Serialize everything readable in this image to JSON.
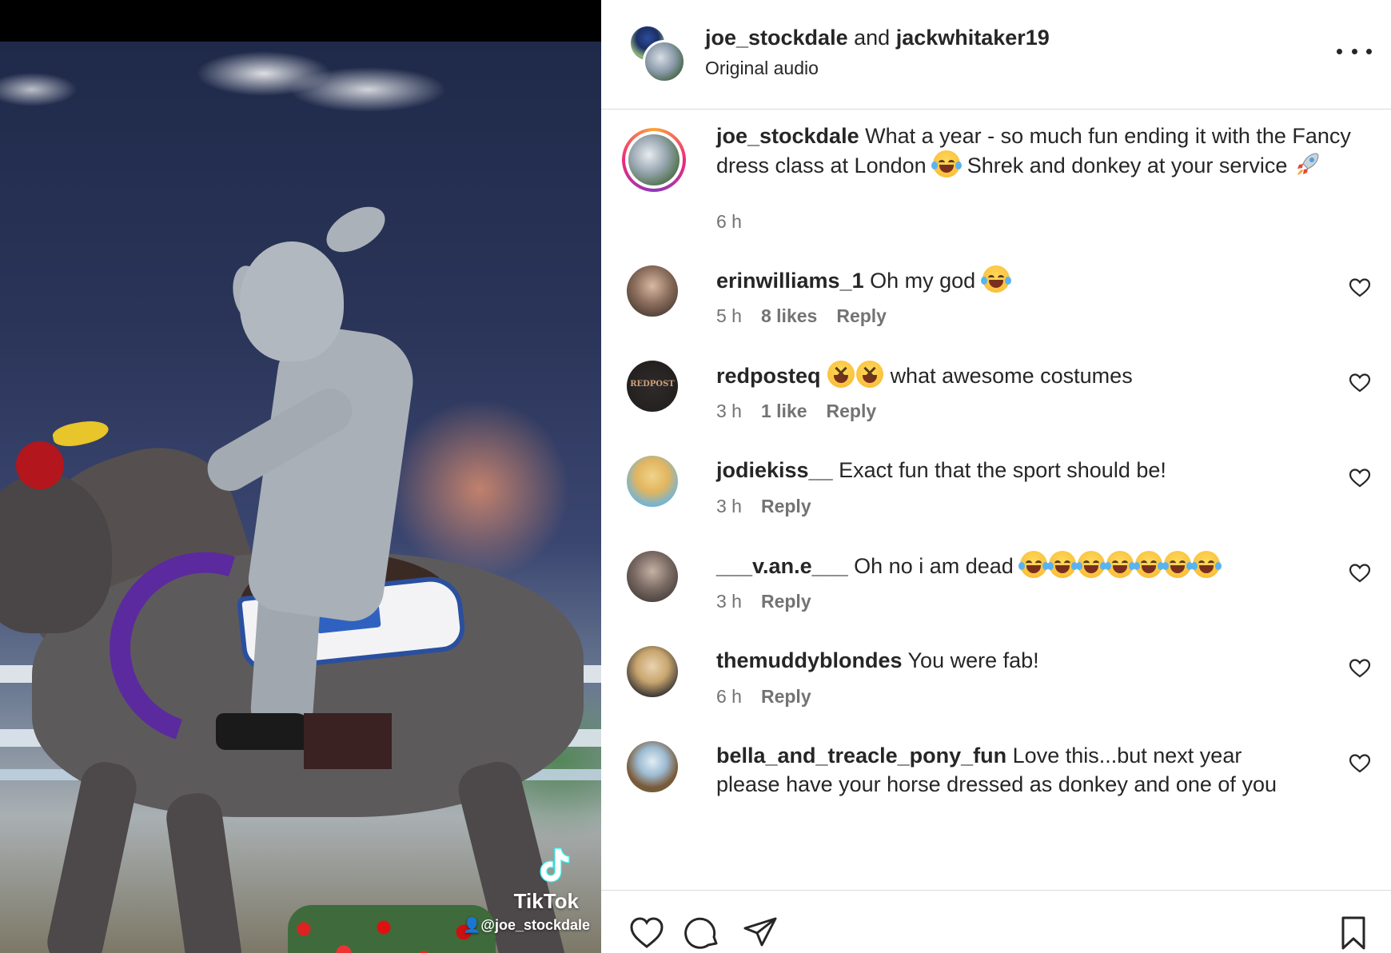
{
  "video": {
    "watermark_brand": "TikTok",
    "watermark_handle": "@joe_stockdale",
    "icons": [
      "tiktok-logo-icon",
      "person-icon"
    ]
  },
  "header": {
    "author1": "joe_stockdale",
    "joiner": "and",
    "author2": "jackwhitaker19",
    "audio": "Original audio",
    "more_icon": "more-icon"
  },
  "caption": {
    "username": "joe_stockdale",
    "text_part1": "What a year - so much fun ending it with the Fancy dress class at London",
    "text_part2": "Shrek and donkey at your service",
    "time": "6 h"
  },
  "comments": [
    {
      "username": "erinwilliams_1",
      "text": "Oh my god",
      "emoji_count": 1,
      "time": "5 h",
      "likes": "8 likes",
      "reply": "Reply"
    },
    {
      "username": "redposteq",
      "text": "what awesome costumes",
      "emoji_count": 2,
      "time": "3 h",
      "likes": "1 like",
      "reply": "Reply",
      "avatar_text": "REDPOST"
    },
    {
      "username": "jodiekiss__",
      "text": "Exact fun that the sport should be!",
      "time": "3 h",
      "reply": "Reply"
    },
    {
      "username": "___v.an.e___",
      "text": "Oh no i am dead",
      "emoji_count": 7,
      "time": "3 h",
      "reply": "Reply"
    },
    {
      "username": "themuddyblondes",
      "text": "You were fab!",
      "time": "6 h",
      "reply": "Reply"
    },
    {
      "username": "bella_and_treacle_pony_fun",
      "text": "Love this...but next year please have your horse dressed as donkey and one of you"
    }
  ],
  "actions": {
    "icons": [
      "heart-icon",
      "comment-icon",
      "share-icon",
      "bookmark-icon"
    ]
  }
}
